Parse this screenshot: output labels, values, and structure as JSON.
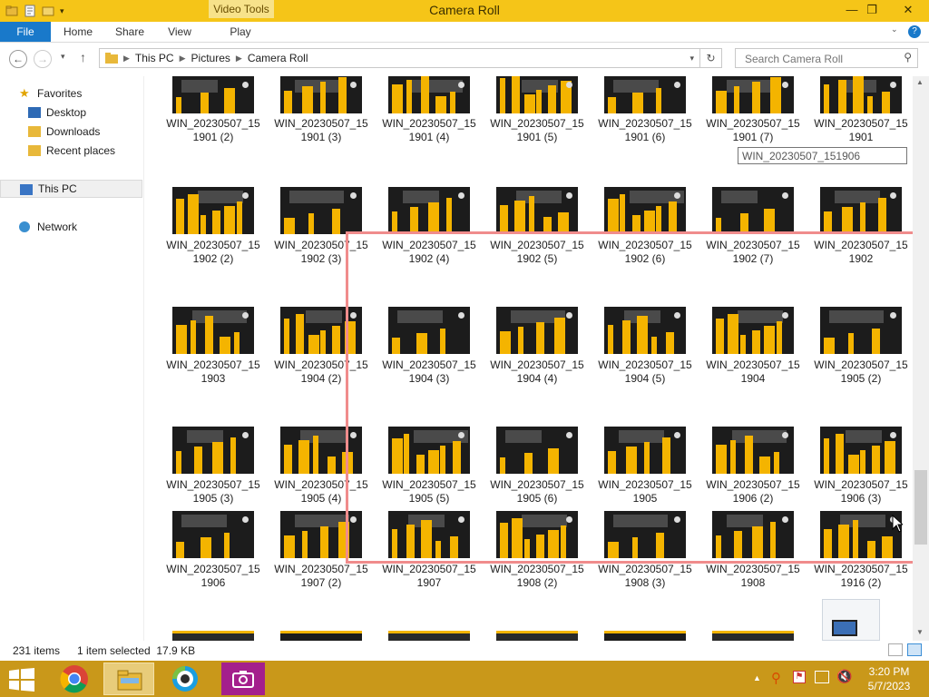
{
  "window": {
    "title": "Camera Roll",
    "contextual_tab": "Video Tools",
    "controls": {
      "minimize": "—",
      "maximize": "❐",
      "close": "✕"
    }
  },
  "ribbon": {
    "tabs": [
      {
        "label": "File",
        "active": true
      },
      {
        "label": "Home"
      },
      {
        "label": "Share"
      },
      {
        "label": "View"
      },
      {
        "label": "Play"
      }
    ]
  },
  "address": {
    "breadcrumbs": [
      "This PC",
      "Pictures",
      "Camera Roll"
    ],
    "search_placeholder": "Search Camera Roll"
  },
  "nav_pane": {
    "favorites": "Favorites",
    "favorite_items": [
      "Desktop",
      "Downloads",
      "Recent places"
    ],
    "this_pc": "This PC",
    "network": "Network"
  },
  "files": [
    [
      "WIN_20230507_15",
      "1901 (2)"
    ],
    [
      "WIN_20230507_15",
      "1901 (3)"
    ],
    [
      "WIN_20230507_15",
      "1901 (4)"
    ],
    [
      "WIN_20230507_15",
      "1901 (5)"
    ],
    [
      "WIN_20230507_15",
      "1901 (6)"
    ],
    [
      "WIN_20230507_15",
      "1901 (7)"
    ],
    [
      "WIN_20230507_15",
      "1901"
    ],
    [
      "WIN_20230507_15",
      "1902 (2)"
    ],
    [
      "WIN_20230507_15",
      "1902 (3)"
    ],
    [
      "WIN_20230507_15",
      "1902 (4)"
    ],
    [
      "WIN_20230507_15",
      "1902 (5)"
    ],
    [
      "WIN_20230507_15",
      "1902 (6)"
    ],
    [
      "WIN_20230507_15",
      "1902 (7)"
    ],
    [
      "WIN_20230507_15",
      "1902"
    ],
    [
      "WIN_20230507_15",
      "1903"
    ],
    [
      "WIN_20230507_15",
      "1904 (2)"
    ],
    [
      "WIN_20230507_15",
      "1904 (3)"
    ],
    [
      "WIN_20230507_15",
      "1904 (4)"
    ],
    [
      "WIN_20230507_15",
      "1904 (5)"
    ],
    [
      "WIN_20230507_15",
      "1904"
    ],
    [
      "WIN_20230507_15",
      "1905 (2)"
    ],
    [
      "WIN_20230507_15",
      "1905 (3)"
    ],
    [
      "WIN_20230507_15",
      "1905 (4)"
    ],
    [
      "WIN_20230507_15",
      "1905 (5)"
    ],
    [
      "WIN_20230507_15",
      "1905 (6)"
    ],
    [
      "WIN_20230507_15",
      "1905"
    ],
    [
      "WIN_20230507_15",
      "1906 (2)"
    ],
    [
      "WIN_20230507_15",
      "1906 (3)"
    ],
    [
      "WIN_20230507_15",
      "1906"
    ],
    [
      "WIN_20230507_15",
      "1907 (2)"
    ],
    [
      "WIN_20230507_15",
      "1907"
    ],
    [
      "WIN_20230507_15",
      "1908 (2)"
    ],
    [
      "WIN_20230507_15",
      "1908 (3)"
    ],
    [
      "WIN_20230507_15",
      "1908"
    ],
    [
      "WIN_20230507_15",
      "1916 (2)"
    ]
  ],
  "tooltip": "WIN_20230507_151906",
  "status": {
    "count": "231 items",
    "selection": "1 item selected  17.9 KB"
  },
  "taskbar": {
    "time": "3:20 PM",
    "date": "5/7/2023"
  },
  "colors": {
    "titlebar": "#f5c518",
    "file_tab": "#1979ca",
    "taskbar": "#c9981a",
    "thumb_accent": "#f4b400",
    "selection_rect": "#f08c8c"
  }
}
